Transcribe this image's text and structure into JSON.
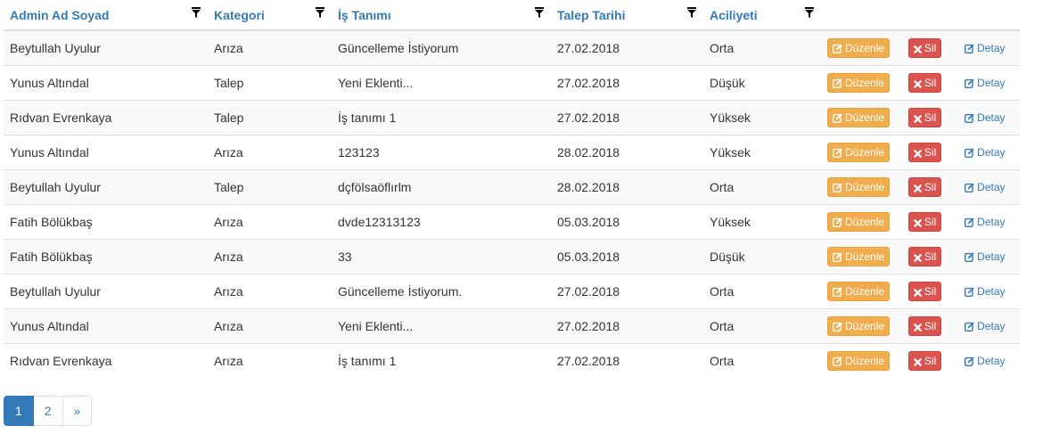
{
  "table": {
    "columns": [
      {
        "label": "Admin Ad Soyad"
      },
      {
        "label": "Kategori"
      },
      {
        "label": "İş Tanımı"
      },
      {
        "label": "Talep Tarihi"
      },
      {
        "label": "Aciliyeti"
      }
    ],
    "rows": [
      {
        "admin": "Beytullah Uyulur",
        "kategori": "Arıza",
        "is_tanimi": "Güncelleme İstiyorum",
        "tarih": "27.02.2018",
        "aciliyet": "Orta"
      },
      {
        "admin": "Yunus Altındal",
        "kategori": "Talep",
        "is_tanimi": "Yeni Eklenti...",
        "tarih": "27.02.2018",
        "aciliyet": "Düşük"
      },
      {
        "admin": "Rıdvan Evrenkaya",
        "kategori": "Talep",
        "is_tanimi": "İş tanımı 1",
        "tarih": "27.02.2018",
        "aciliyet": "Yüksek"
      },
      {
        "admin": "Yunus Altındal",
        "kategori": "Arıza",
        "is_tanimi": "123123",
        "tarih": "28.02.2018",
        "aciliyet": "Yüksek"
      },
      {
        "admin": "Beytullah Uyulur",
        "kategori": "Talep",
        "is_tanimi": "dçfölsaöflırlm",
        "tarih": "28.02.2018",
        "aciliyet": "Orta"
      },
      {
        "admin": "Fatih Bölükbaş",
        "kategori": "Arıza",
        "is_tanimi": "dvde12313123",
        "tarih": "05.03.2018",
        "aciliyet": "Yüksek"
      },
      {
        "admin": "Fatih Bölükbaş",
        "kategori": "Arıza",
        "is_tanimi": "33",
        "tarih": "05.03.2018",
        "aciliyet": "Düşük"
      },
      {
        "admin": "Beytullah Uyulur",
        "kategori": "Arıza",
        "is_tanimi": "Güncelleme İstiyorum.",
        "tarih": "27.02.2018",
        "aciliyet": "Orta"
      },
      {
        "admin": "Yunus Altındal",
        "kategori": "Arıza",
        "is_tanimi": "Yeni Eklenti...",
        "tarih": "27.02.2018",
        "aciliyet": "Orta"
      },
      {
        "admin": "Rıdvan Evrenkaya",
        "kategori": "Arıza",
        "is_tanimi": "İş tanımı 1",
        "tarih": "27.02.2018",
        "aciliyet": "Orta"
      }
    ]
  },
  "actions": {
    "edit_label": "Düzenle",
    "delete_label": "Sil",
    "detail_label": "Detay",
    "edit_icon": "edit-icon",
    "delete_icon": "times-icon",
    "detail_icon": "edit-icon",
    "filter_icon": "filter-icon"
  },
  "pagination": {
    "pages": [
      "1",
      "2"
    ],
    "active": "1",
    "next_label": "»"
  },
  "colors": {
    "link": "#337ab7",
    "warning": "#f0ad4e",
    "danger": "#d9534f",
    "row_stripe": "#f9f9f9",
    "border": "#dddddd"
  }
}
